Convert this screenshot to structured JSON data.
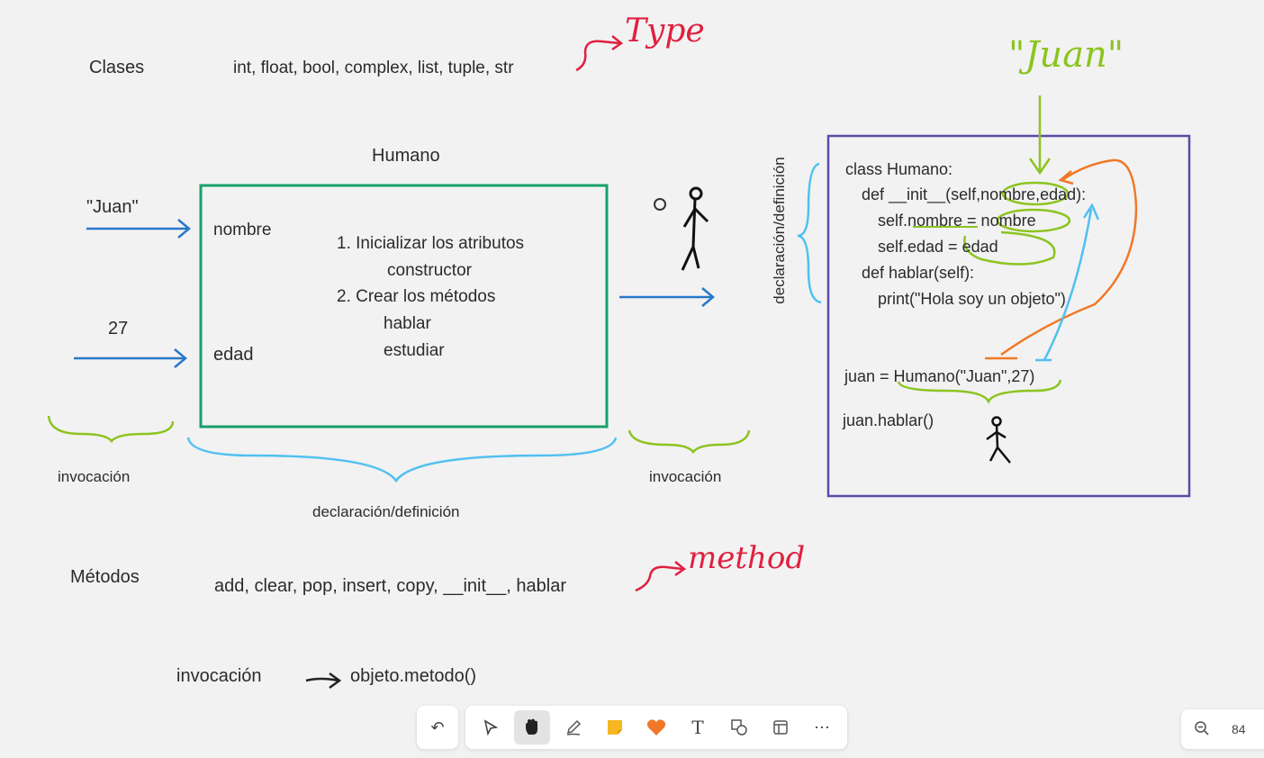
{
  "canvas": {
    "clases_label": "Clases",
    "clases_list": "int, float, bool, complex, list, tuple, str",
    "type_note": "Type",
    "class_title": "Humano",
    "input_juan": "\"Juan\"",
    "input_27": "27",
    "attr_nombre": "nombre",
    "attr_edad": "edad",
    "steps": [
      "1. Inicializar los atributos",
      "constructor",
      "2. Crear los métodos",
      "hablar",
      "estudiar"
    ],
    "invocacion_left": "invocación",
    "invocacion_right": "invocación",
    "declaracion_bottom": "declaración/definición",
    "declaracion_vertical": "declaración/definición",
    "juan_note": "\"Juan\"",
    "code": [
      "class Humano:",
      "def __init__(self,nombre,edad):",
      "self.nombre = nombre",
      "self.edad = edad",
      "def hablar(self):",
      "print(\"Hola soy un objeto\")"
    ],
    "code_instance": "juan = Humano(\"Juan\",27)",
    "code_call": "juan.hablar()",
    "metodos_label": "Métodos",
    "metodos_list": "add, clear,  pop, insert, copy, __init__, hablar",
    "method_note": "method",
    "invocacion_bottom": "invocación",
    "objeto_metodo": "objeto.metodo()"
  },
  "colors": {
    "class_box": "#17a06a",
    "code_box": "#5a4aa8",
    "blue_arrow": "#2878c8",
    "green_ink": "#8cc420",
    "red_ink": "#e02040",
    "cyan_ink": "#50c0f0",
    "orange_ink": "#f07828"
  },
  "toolbar": {
    "undo_icon": "undo-icon",
    "tools": [
      "select-icon",
      "hand-icon",
      "pen-icon",
      "sticky-note-icon",
      "heart-icon",
      "text-icon",
      "shapes-icon",
      "frame-icon",
      "more-icon"
    ],
    "active_tool": "hand-icon"
  },
  "zoom": {
    "value": "84"
  }
}
